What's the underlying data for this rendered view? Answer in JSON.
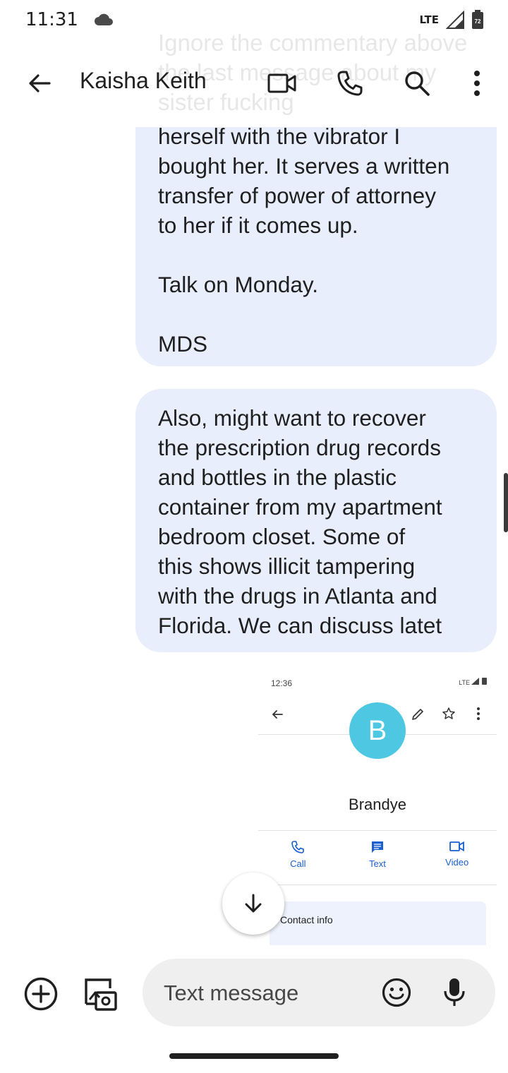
{
  "status_bar": {
    "time": "11:31",
    "network": "LTE",
    "battery": "72"
  },
  "app_bar": {
    "contact_name": "Kaisha Keith"
  },
  "ghost_text": "Ignore the commentary above the last message about my sister fucking",
  "messages": [
    {
      "text": "herself with the vibrator I\nbought her. It serves a written\ntransfer of power of attorney\nto her if it comes up.\n\nTalk on Monday.\n\nMDS"
    },
    {
      "text": "Also, might want to recover\nthe prescription drug records\nand bottles in the plastic\ncontainer from my apartment\nbedroom closet. Some of\nthis shows illicit tampering\nwith the drugs in Atlanta and\nFlorida. We can discuss latet"
    }
  ],
  "attachment": {
    "time": "12:36",
    "network": "LTE",
    "avatar_letter": "B",
    "contact_name": "Brandye",
    "actions": {
      "call": "Call",
      "text": "Text",
      "video": "Video"
    },
    "card_title": "Contact info"
  },
  "compose": {
    "placeholder": "Text message"
  },
  "icons": {
    "back": "arrow-back-icon",
    "video": "videocam-icon",
    "call": "phone-icon",
    "search": "search-icon",
    "more": "more-vert-icon",
    "add": "add-circle-icon",
    "gallery": "gallery-camera-icon",
    "emoji": "emoji-icon",
    "mic": "mic-icon",
    "scroll": "arrow-down-icon"
  }
}
